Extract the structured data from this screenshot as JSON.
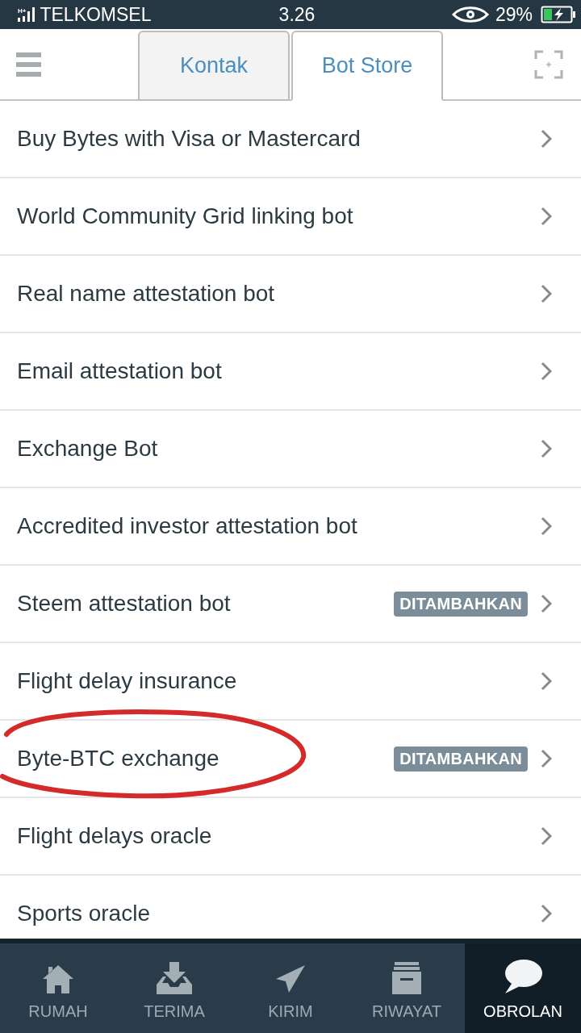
{
  "status_bar": {
    "network": "H+",
    "carrier": "TELKOMSEL",
    "time": "3.26",
    "battery": "29%"
  },
  "header": {
    "tabs": [
      {
        "label": "Kontak",
        "selected": false
      },
      {
        "label": "Bot Store",
        "selected": true
      }
    ]
  },
  "bots": [
    {
      "name": "Buy Bytes with Visa or Mastercard",
      "circled": false
    },
    {
      "name": "World Community Grid linking bot",
      "circled": false
    },
    {
      "name": "Real name attestation bot",
      "circled": false
    },
    {
      "name": "Email attestation bot",
      "circled": false
    },
    {
      "name": "Exchange Bot",
      "circled": false
    },
    {
      "name": "Accredited investor attestation bot",
      "circled": false
    },
    {
      "name": "Steem attestation bot",
      "badge": "DITAMBAHKAN",
      "circled": false
    },
    {
      "name": "Flight delay insurance",
      "circled": false
    },
    {
      "name": "Byte-BTC exchange",
      "badge": "DITAMBAHKAN",
      "circled": true
    },
    {
      "name": "Flight delays oracle",
      "circled": false
    },
    {
      "name": "Sports oracle",
      "circled": false
    }
  ],
  "bottom_nav": [
    {
      "label": "RUMAH",
      "selected": false
    },
    {
      "label": "TERIMA",
      "selected": false
    },
    {
      "label": "KIRIM",
      "selected": false
    },
    {
      "label": "RIWAYAT",
      "selected": false
    },
    {
      "label": "OBROLAN",
      "selected": true
    }
  ]
}
